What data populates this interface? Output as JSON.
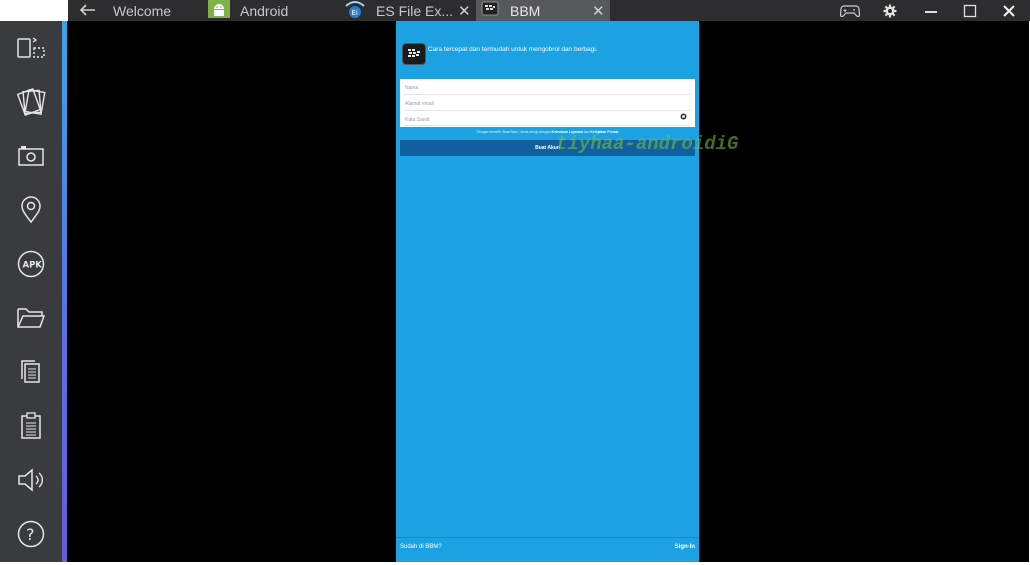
{
  "tabs": [
    {
      "label": "Welcome",
      "icon": "back-arrow-icon"
    },
    {
      "label": "Android",
      "icon": "android-icon"
    },
    {
      "label": "ES File Ex...",
      "icon": "es-file-explorer-icon"
    },
    {
      "label": "BBM",
      "icon": "bbm-icon",
      "active": true
    }
  ],
  "window_controls": [
    "gamepad-icon",
    "settings-icon",
    "minimize-icon",
    "maximize-icon",
    "close-icon"
  ],
  "sidebar": {
    "items": [
      {
        "icon": "rotate-screen-icon",
        "apk_label": ""
      },
      {
        "icon": "cards-icon"
      },
      {
        "icon": "camera-icon"
      },
      {
        "icon": "location-icon"
      },
      {
        "icon": "apk-icon",
        "label": "APK"
      },
      {
        "icon": "folder-icon"
      },
      {
        "icon": "copy-icon"
      },
      {
        "icon": "clipboard-icon"
      },
      {
        "icon": "volume-icon"
      },
      {
        "icon": "help-icon",
        "label": "?"
      }
    ]
  },
  "bbm": {
    "tagline": "Cara tercepat dan termudah untuk mengobrol dan berbagi.",
    "form": {
      "name_placeholder": "Nama",
      "email_placeholder": "Alamat email",
      "password_placeholder": "Kata Sandi"
    },
    "terms_prefix": "Dengan memilih 'Buat Akun', Anda setuju dengan ",
    "terms_link1": "Ketentuan Layanan",
    "terms_mid": " dan ",
    "terms_link2": "Kebijakan Privasi",
    "create_button": "Buat Akun",
    "footer_left": "Sudah di BBM?",
    "footer_right": "Sign-In"
  },
  "watermark": "tiyhaa-androidiG",
  "colors": {
    "titlebar": "#2d2d2f",
    "active_tab": "#57585c",
    "sidebar": "#3a3b3f",
    "bbm_blue": "#1ca1e2",
    "button_dark_blue": "#115f9e"
  }
}
